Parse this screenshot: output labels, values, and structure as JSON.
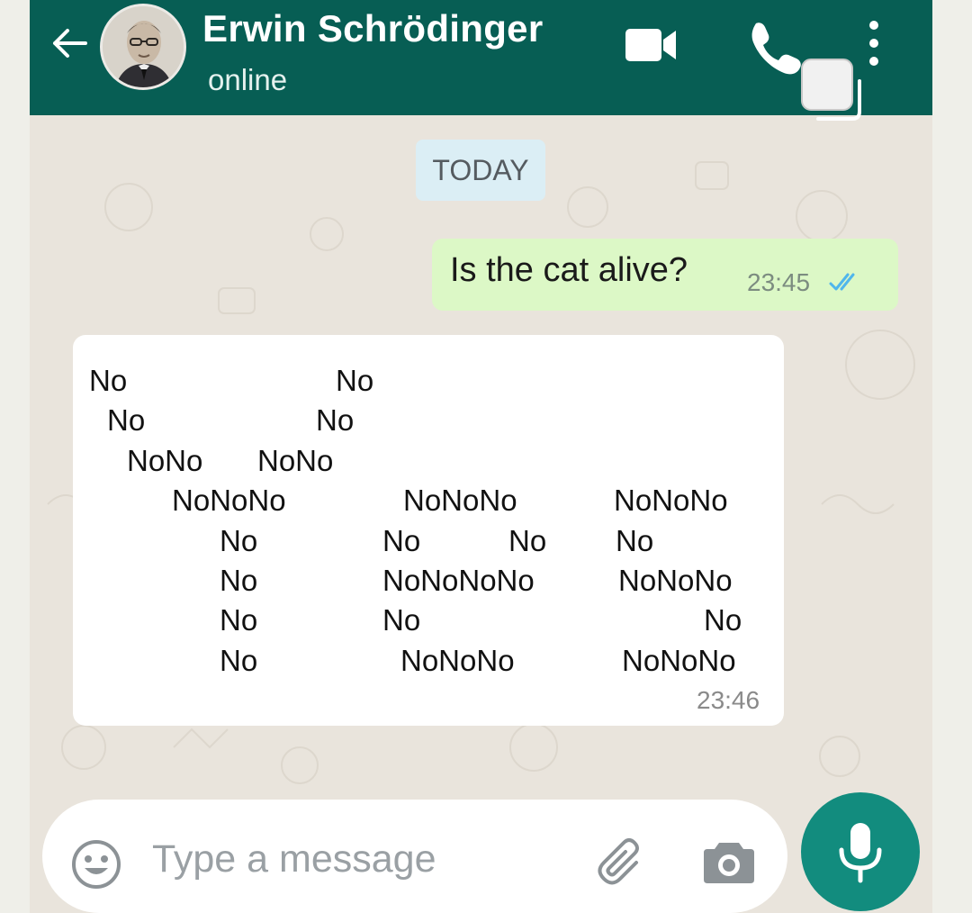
{
  "header": {
    "contact_name": "Erwin Schrödinger",
    "status": "online",
    "icons": [
      "back-arrow-icon",
      "avatar",
      "video-call-icon",
      "phone-icon",
      "more-vert-icon",
      "pip-window-icon"
    ]
  },
  "chat": {
    "date_chip": "TODAY",
    "outgoing": {
      "text": "Is the cat alive?",
      "time": "23:45",
      "status": "read"
    },
    "incoming": {
      "art_lines": [
        "No",
        "No",
        "No",
        "No",
        "NoNo",
        "NoNo",
        "NoNoNo",
        "NoNoNo",
        "NoNoNo",
        "No",
        "No",
        "No",
        "No",
        "No",
        "NoNoNoNo",
        "NoNoNo",
        "No",
        "No",
        "No",
        "No",
        "NoNoNo",
        "NoNoNo"
      ],
      "time": "23:46"
    }
  },
  "composer": {
    "placeholder": "Type a message",
    "icons": [
      "emoji-icon",
      "attach-icon",
      "camera-icon",
      "mic-icon"
    ]
  },
  "colors": {
    "header": "#075e54",
    "outgoing_bubble": "#dcf8c6",
    "mic_button": "#128c7e",
    "read_ticks": "#4fb6ec"
  }
}
